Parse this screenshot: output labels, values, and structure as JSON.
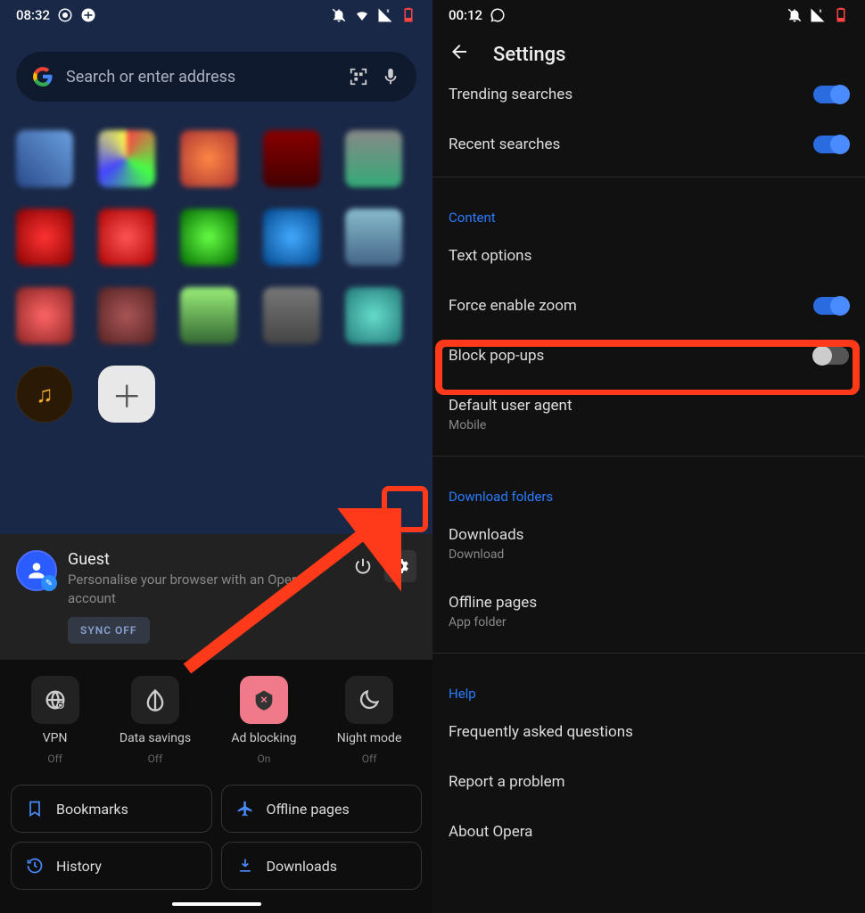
{
  "left": {
    "status": {
      "time": "08:32",
      "battery_low": true
    },
    "search": {
      "placeholder": "Search or enter address"
    },
    "profile": {
      "title": "Guest",
      "subtitle": "Personalise your browser with an Opera account",
      "sync_badge": "SYNC OFF"
    },
    "features": [
      {
        "label": "VPN",
        "state": "Off",
        "active": false,
        "icon": "globe"
      },
      {
        "label": "Data savings",
        "state": "Off",
        "active": false,
        "icon": "leaf"
      },
      {
        "label": "Ad blocking",
        "state": "On",
        "active": true,
        "icon": "blockx"
      },
      {
        "label": "Night mode",
        "state": "Off",
        "active": false,
        "icon": "moon"
      }
    ],
    "buttons": [
      {
        "label": "Bookmarks",
        "icon": "bookmark"
      },
      {
        "label": "Offline pages",
        "icon": "plane"
      },
      {
        "label": "History",
        "icon": "history"
      },
      {
        "label": "Downloads",
        "icon": "download"
      }
    ]
  },
  "right": {
    "status": {
      "time": "00:12"
    },
    "header": {
      "title": "Settings"
    },
    "rows": {
      "trending": "Trending searches",
      "recent": "Recent searches",
      "content_section": "Content",
      "text_options": "Text options",
      "force_zoom": "Force enable zoom",
      "block_popups": "Block pop-ups",
      "default_ua": "Default user agent",
      "default_ua_sub": "Mobile",
      "download_section": "Download folders",
      "downloads": "Downloads",
      "downloads_sub": "Download",
      "offline_pages": "Offline pages",
      "offline_pages_sub": "App folder",
      "help_section": "Help",
      "faq": "Frequently asked questions",
      "report": "Report a problem",
      "about": "About Opera"
    }
  }
}
